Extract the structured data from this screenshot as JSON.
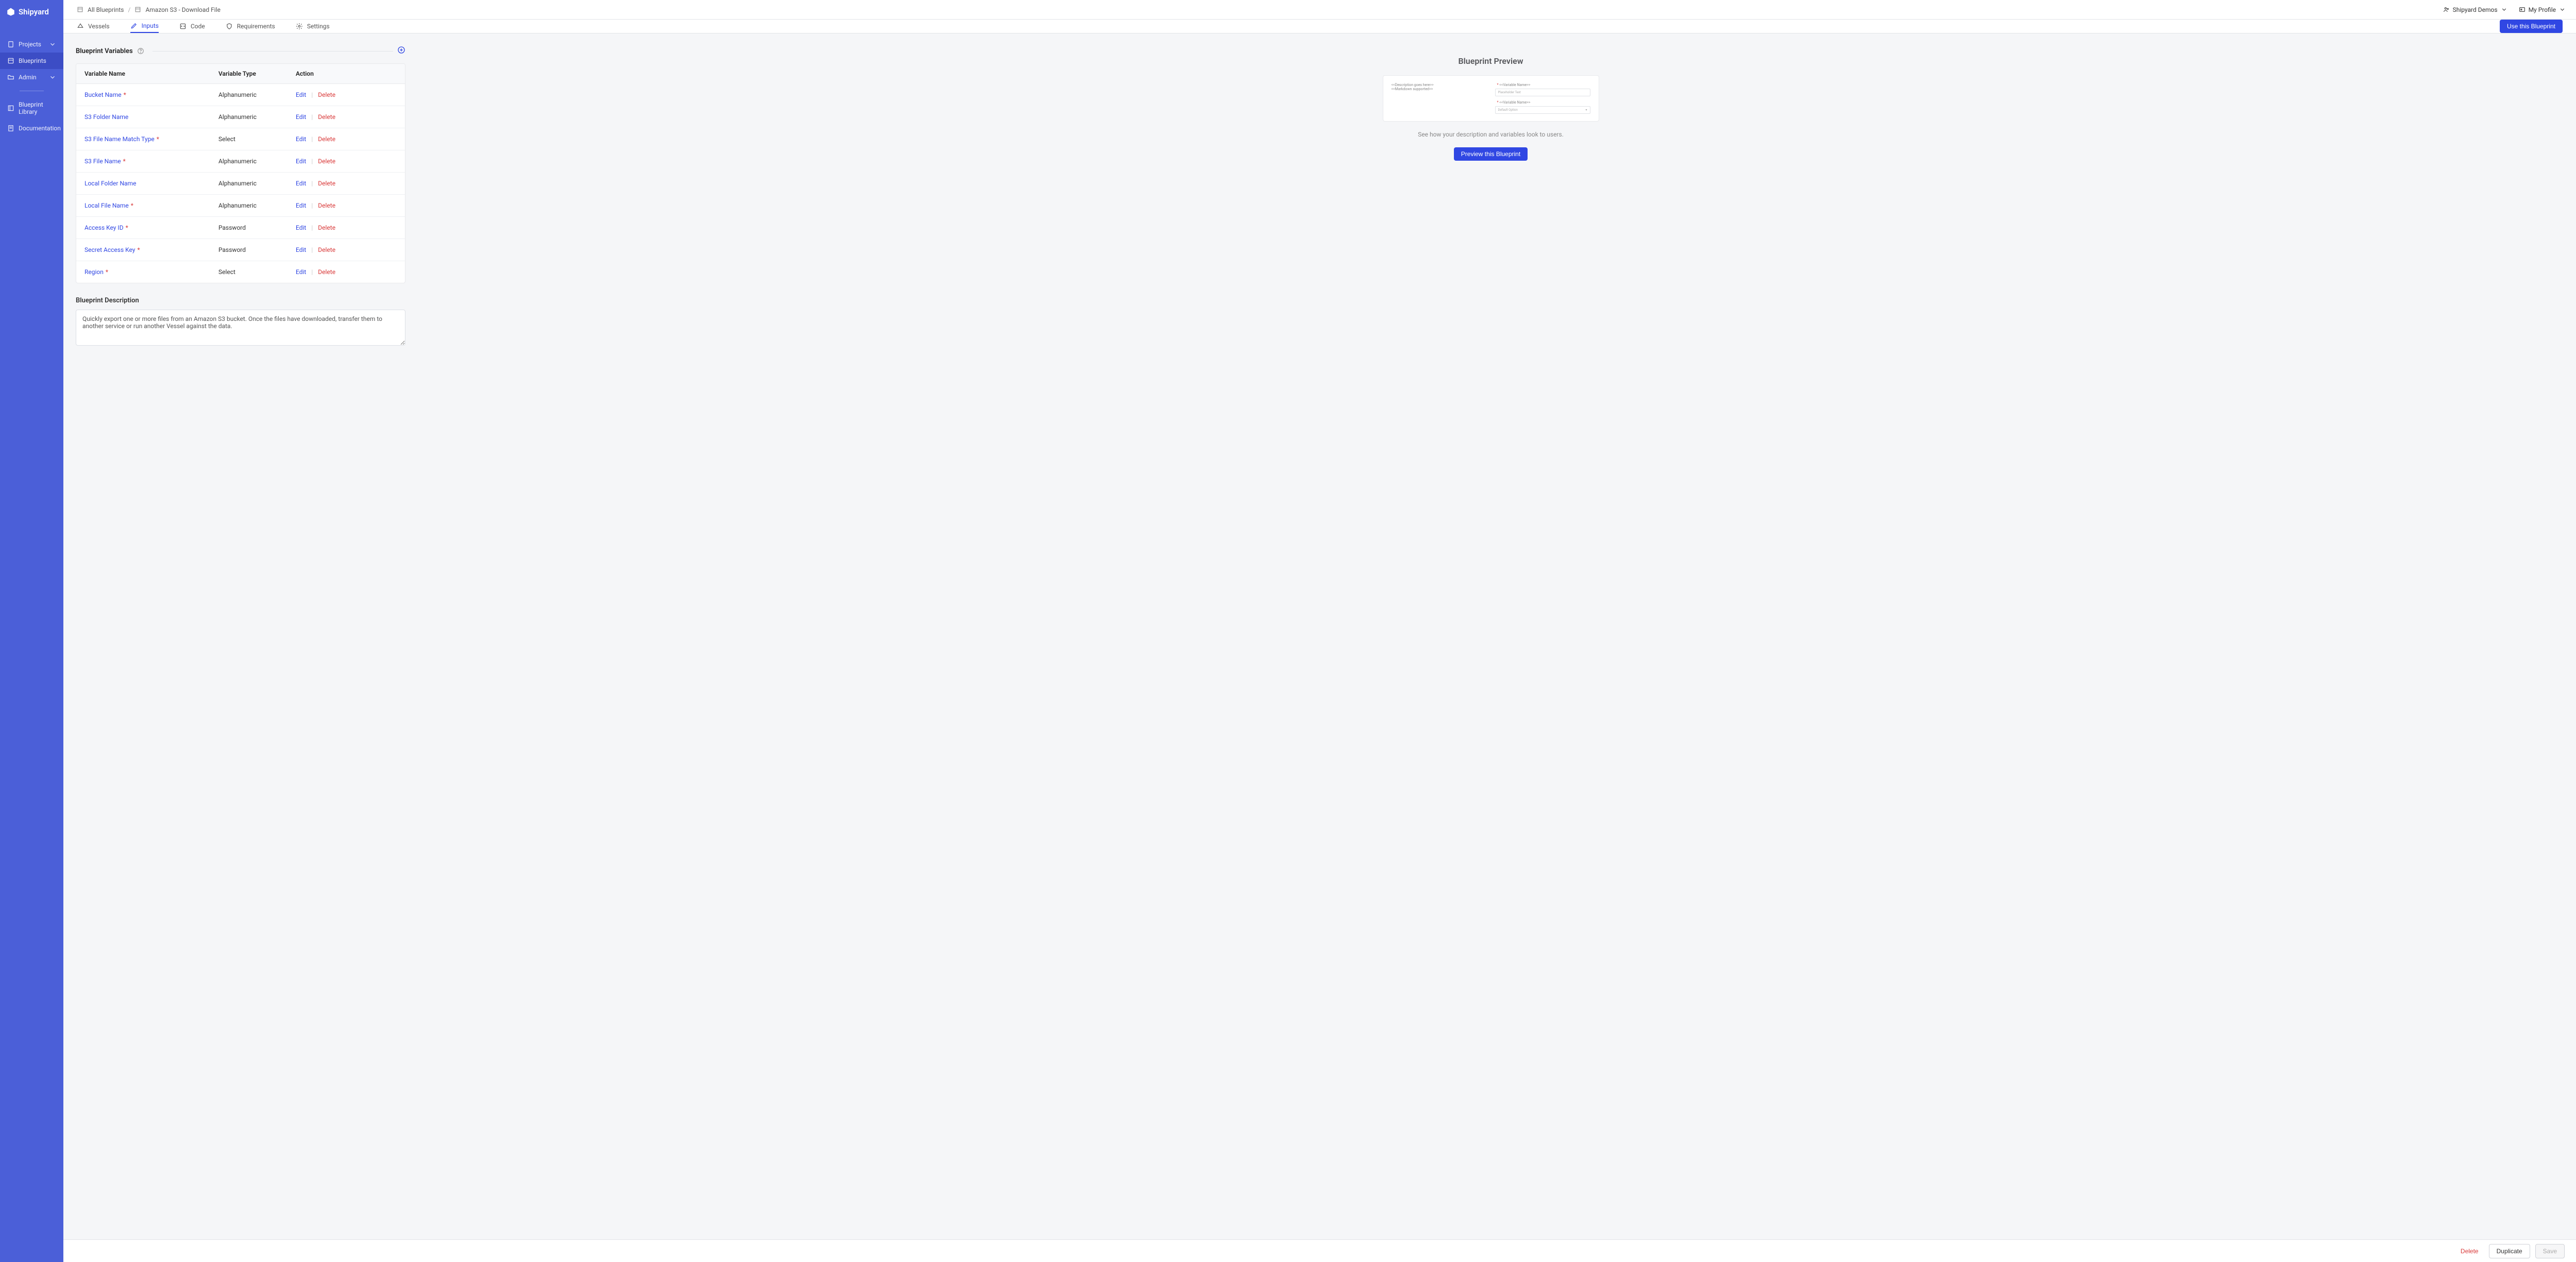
{
  "brand": "Shipyard",
  "sidebar": {
    "items": [
      {
        "label": "Projects",
        "icon": "file-icon",
        "expandable": true
      },
      {
        "label": "Blueprints",
        "icon": "blueprint-icon",
        "active": true
      },
      {
        "label": "Admin",
        "icon": "folder-icon",
        "expandable": true
      }
    ],
    "secondary": [
      {
        "label": "Blueprint Library",
        "icon": "library-icon"
      },
      {
        "label": "Documentation",
        "icon": "doc-icon"
      }
    ]
  },
  "breadcrumb": {
    "root": "All Blueprints",
    "current": "Amazon S3 - Download File"
  },
  "topbar": {
    "org": "Shipyard Demos",
    "profile": "My Profile"
  },
  "tabs": [
    {
      "label": "Vessels",
      "icon": "vessel-icon"
    },
    {
      "label": "Inputs",
      "icon": "pencil-icon",
      "active": true
    },
    {
      "label": "Code",
      "icon": "code-icon"
    },
    {
      "label": "Requirements",
      "icon": "shield-icon"
    },
    {
      "label": "Settings",
      "icon": "gear-icon"
    }
  ],
  "actions": {
    "use_blueprint": "Use this Blueprint",
    "preview_blueprint": "Preview this Blueprint",
    "delete": "Delete",
    "duplicate": "Duplicate",
    "save": "Save",
    "edit": "Edit",
    "row_delete": "Delete"
  },
  "variables_section": {
    "title": "Blueprint Variables",
    "columns": {
      "name": "Variable Name",
      "type": "Variable Type",
      "action": "Action"
    },
    "rows": [
      {
        "name": "Bucket Name",
        "required": true,
        "type": "Alphanumeric"
      },
      {
        "name": "S3 Folder Name",
        "required": false,
        "type": "Alphanumeric"
      },
      {
        "name": "S3 File Name Match Type",
        "required": true,
        "type": "Select"
      },
      {
        "name": "S3 File Name",
        "required": true,
        "type": "Alphanumeric"
      },
      {
        "name": "Local Folder Name",
        "required": false,
        "type": "Alphanumeric"
      },
      {
        "name": "Local File Name",
        "required": true,
        "type": "Alphanumeric"
      },
      {
        "name": "Access Key ID",
        "required": true,
        "type": "Password"
      },
      {
        "name": "Secret Access Key",
        "required": true,
        "type": "Password"
      },
      {
        "name": "Region",
        "required": true,
        "type": "Select"
      }
    ]
  },
  "description": {
    "label": "Blueprint Description",
    "value": "Quickly export one or more files from an Amazon S3 bucket. Once the files have downloaded, transfer them to another service or run another Vessel against the data."
  },
  "preview": {
    "title": "Blueprint Preview",
    "hint": "See how your description and variables look to users.",
    "mock": {
      "desc1": "<<Description goes here>>",
      "desc2": "<<Markdown supported>>",
      "var_label": "<<Variable Name>>",
      "placeholder": "Placeholder Text",
      "default_option": "Default Option"
    }
  }
}
